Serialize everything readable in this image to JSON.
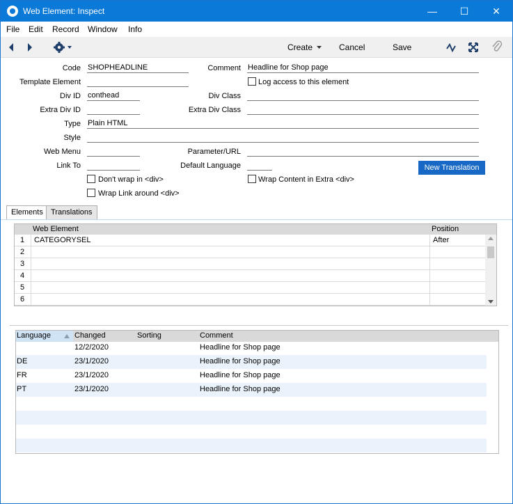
{
  "window": {
    "title": "Web Element: Inspect",
    "controls": {
      "minimize": "—",
      "maximize": "☐",
      "close": "✕"
    }
  },
  "menu": [
    "File",
    "Edit",
    "Record",
    "Window",
    "Info"
  ],
  "toolbar": {
    "create_label": "Create",
    "cancel_label": "Cancel",
    "save_label": "Save"
  },
  "form": {
    "labels": {
      "code": "Code",
      "template_element": "Template Element",
      "div_id": "Div ID",
      "extra_div_id": "Extra Div ID",
      "type": "Type",
      "style": "Style",
      "web_menu": "Web Menu",
      "link_to": "Link To",
      "comment": "Comment",
      "div_class": "Div Class",
      "extra_div_class": "Extra Div Class",
      "parameter_url": "Parameter/URL",
      "default_language": "Default Language"
    },
    "values": {
      "code": "SHOPHEADLINE",
      "template_element": "",
      "div_id": "conthead",
      "extra_div_id": "",
      "type": "Plain HTML",
      "style": "",
      "web_menu": "",
      "link_to": "",
      "comment": "Headline for Shop  page",
      "div_class": "",
      "extra_div_class": "",
      "parameter_url": "",
      "default_language": ""
    },
    "checkboxes": {
      "log_access": "Log access to this element",
      "dont_wrap": "Don't wrap in <div>",
      "wrap_link": "Wrap Link around <div>",
      "wrap_content": "Wrap Content in Extra <div>"
    },
    "new_translation_label": "New Translation"
  },
  "tabs": [
    "Elements",
    "Translations"
  ],
  "elements_grid": {
    "headers": [
      "Web Element",
      "Position"
    ],
    "rows": [
      {
        "num": "1",
        "element": "CATEGORYSEL",
        "position": "After"
      },
      {
        "num": "2",
        "element": "",
        "position": ""
      },
      {
        "num": "3",
        "element": "",
        "position": ""
      },
      {
        "num": "4",
        "element": "",
        "position": ""
      },
      {
        "num": "5",
        "element": "",
        "position": ""
      },
      {
        "num": "6",
        "element": "",
        "position": ""
      }
    ]
  },
  "translations_grid": {
    "headers": [
      "Language",
      "Changed",
      "Sorting",
      "Comment"
    ],
    "rows": [
      {
        "language": "",
        "changed": "12/2/2020",
        "sorting": "",
        "comment": "Headline for Shop page"
      },
      {
        "language": "DE",
        "changed": "23/1/2020",
        "sorting": "",
        "comment": "Headline for Shop page"
      },
      {
        "language": "FR",
        "changed": "23/1/2020",
        "sorting": "",
        "comment": "Headline for Shop page"
      },
      {
        "language": "PT",
        "changed": "23/1/2020",
        "sorting": "",
        "comment": "Headline for Shop page"
      }
    ]
  },
  "colors": {
    "titlebar": "#0a79d7",
    "accent_button": "#1769c5",
    "alt_row": "#eaf3fb"
  }
}
